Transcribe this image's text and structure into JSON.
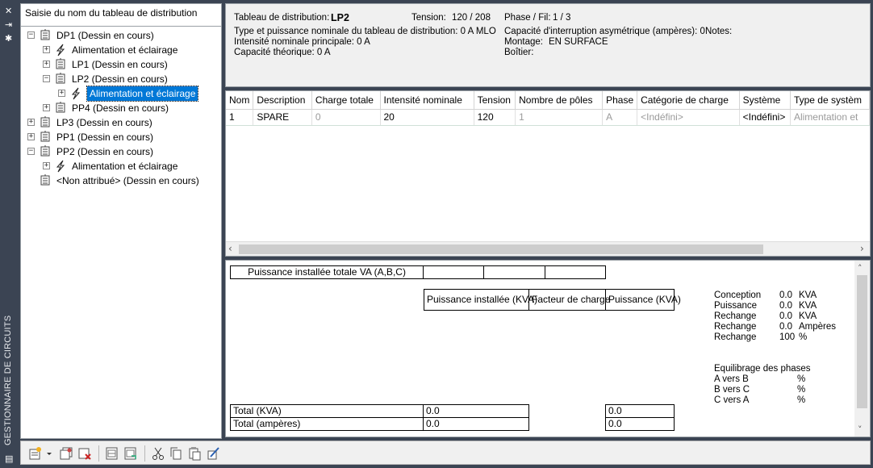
{
  "sidebar_title": "GESTIONNAIRE DE CIRCUITS",
  "tree": {
    "header_placeholder": "Saisie du nom du tableau de distribution",
    "nodes": [
      {
        "label": "DP1 (Dessin en cours)",
        "type": "panel",
        "expander": "−"
      },
      {
        "label": "Alimentation et éclairage",
        "type": "power",
        "expander": "+"
      },
      {
        "label": "LP1 (Dessin en cours)",
        "type": "panel",
        "expander": "+"
      },
      {
        "label": "LP2 (Dessin en cours)",
        "type": "panel",
        "expander": "−"
      },
      {
        "label": "Alimentation et éclairage",
        "type": "power",
        "expander": "+",
        "selected": true
      },
      {
        "label": "PP4 (Dessin en cours)",
        "type": "panel",
        "expander": "+"
      },
      {
        "label": "LP3 (Dessin en cours)",
        "type": "panel",
        "expander": "+"
      },
      {
        "label": "PP1 (Dessin en cours)",
        "type": "panel",
        "expander": "+"
      },
      {
        "label": "PP2 (Dessin en cours)",
        "type": "panel",
        "expander": "−"
      },
      {
        "label": "Alimentation et éclairage",
        "type": "power",
        "expander": "+"
      },
      {
        "label": "<Non attribué> (Dessin en cours)",
        "type": "panel",
        "expander": ""
      }
    ]
  },
  "info": {
    "panel_label": "Tableau de distribution:",
    "panel_value": "LP2",
    "tension_label": "Tension:",
    "tension_value": "120 / 208",
    "phase_label": "Phase / Fil:",
    "phase_value": "1 /  3",
    "type_line": "Type et puissance nominale du tableau de distribution: 0 A MLO",
    "capacity_interrupt": "Capacité d'interruption asymétrique (ampères):   0",
    "notes_label": "Notes:",
    "main_current": "Intensité nominale principale: 0 A",
    "mounting_label": "Montage:",
    "mounting_value": "EN SURFACE",
    "theoretical": "Capacité théorique: 0 A",
    "enclosure_label": "Boîtier:"
  },
  "circuit_table": {
    "columns": [
      "Nom",
      "Description",
      "Charge totale",
      "Intensité nominale",
      "Tension",
      "Nombre de pôles",
      "Phase",
      "Catégorie de charge",
      "Système",
      "Type de systèm"
    ],
    "rows": [
      [
        "1",
        "SPARE",
        "0",
        "20",
        "120",
        "1",
        "A",
        "<Indéfini>",
        "<Indéfini>",
        "Alimentation et"
      ]
    ]
  },
  "summary": {
    "installed_total_label": "Puissance installée totale VA (A,B,C)",
    "col_installed": "Puissance installée (KVA)",
    "col_load_factor": "Facteur de charge",
    "col_power": "Puissance (KVA)",
    "total_kva_label": "Total (KVA)",
    "total_kva_installed": "0.0",
    "total_kva_power": "0.0",
    "total_amp_label": "Total (ampères)",
    "total_amp_installed": "0.0",
    "total_amp_power": "0.0",
    "stats": [
      {
        "label": "Conception",
        "value": "0.0",
        "unit": "KVA"
      },
      {
        "label": "Puissance",
        "value": "0.0",
        "unit": "KVA"
      },
      {
        "label": "Rechange",
        "value": "0.0",
        "unit": "KVA"
      },
      {
        "label": "Rechange",
        "value": "0.0",
        "unit": "Ampères"
      },
      {
        "label": "Rechange",
        "value": "100",
        "unit": "%"
      }
    ],
    "balance_title": "Equilibrage des phases",
    "balance": [
      {
        "label": "A vers B",
        "unit": "%"
      },
      {
        "label": "B vers C",
        "unit": "%"
      },
      {
        "label": "C vers A",
        "unit": "%"
      }
    ]
  },
  "toolbar_icons": [
    "new-panel-icon",
    "dropdown-arrow-icon",
    "copy-panel-icon",
    "delete-panel-icon",
    "schedule-icon",
    "schedule-update-icon",
    "cut-icon",
    "copy-icon",
    "paste-icon",
    "edit-properties-icon"
  ]
}
